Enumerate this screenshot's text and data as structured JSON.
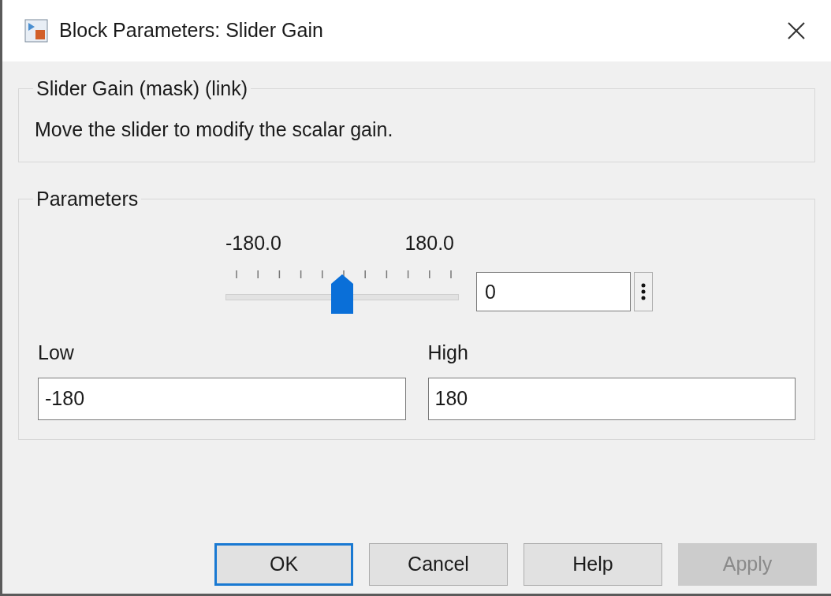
{
  "window": {
    "title": "Block Parameters: Slider Gain"
  },
  "description_group": {
    "legend": "Slider Gain (mask) (link)",
    "text": "Move the slider to modify the scalar gain."
  },
  "parameters_group": {
    "legend": "Parameters",
    "slider": {
      "min_label": "-180.0",
      "max_label": "180.0",
      "level": 0.5
    },
    "value_field": {
      "value": "0"
    },
    "low": {
      "label": "Low",
      "value": "-180"
    },
    "high": {
      "label": "High",
      "value": "180"
    }
  },
  "buttons": [
    {
      "label": "OK",
      "default": true,
      "disabled": false
    },
    {
      "label": "Cancel",
      "default": false,
      "disabled": false
    },
    {
      "label": "Help",
      "default": false,
      "disabled": false
    },
    {
      "label": "Apply",
      "default": false,
      "disabled": true
    }
  ]
}
